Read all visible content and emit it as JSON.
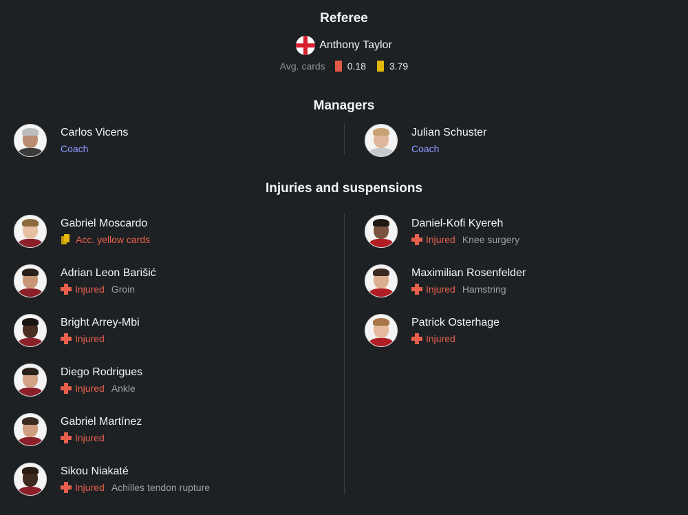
{
  "referee": {
    "title": "Referee",
    "name": "Anthony Taylor",
    "flag_icon": "england-flag-icon",
    "avg_label": "Avg. cards",
    "red_avg": "0.18",
    "yellow_avg": "3.79"
  },
  "managers": {
    "title": "Managers",
    "home": {
      "name": "Carlos Vicens",
      "role": "Coach"
    },
    "away": {
      "name": "Julian Schuster",
      "role": "Coach"
    }
  },
  "injuries": {
    "title": "Injuries and suspensions",
    "home": [
      {
        "name": "Gabriel Moscardo",
        "status": "Acc. yellow cards",
        "reason": "",
        "type": "suspension"
      },
      {
        "name": "Adrian Leon Barišić",
        "status": "Injured",
        "reason": "Groin",
        "type": "injury"
      },
      {
        "name": "Bright Arrey-Mbi",
        "status": "Injured",
        "reason": "",
        "type": "injury"
      },
      {
        "name": "Diego Rodrigues",
        "status": "Injured",
        "reason": "Ankle",
        "type": "injury"
      },
      {
        "name": "Gabriel Martínez",
        "status": "Injured",
        "reason": "",
        "type": "injury"
      },
      {
        "name": "Sikou Niakaté",
        "status": "Injured",
        "reason": "Achilles tendon rupture",
        "type": "injury"
      }
    ],
    "away": [
      {
        "name": "Daniel-Kofi Kyereh",
        "status": "Injured",
        "reason": "Knee surgery",
        "type": "injury"
      },
      {
        "name": "Maximilian Rosenfelder",
        "status": "Injured",
        "reason": "Hamstring",
        "type": "injury"
      },
      {
        "name": "Patrick Osterhage",
        "status": "Injured",
        "reason": "",
        "type": "injury"
      }
    ]
  },
  "colors": {
    "background": "#1e2124",
    "injured_red": "#e8604c",
    "coach_blue": "#8f9bff",
    "yellow_card": "#e3b70b",
    "red_card": "#e05a47"
  }
}
